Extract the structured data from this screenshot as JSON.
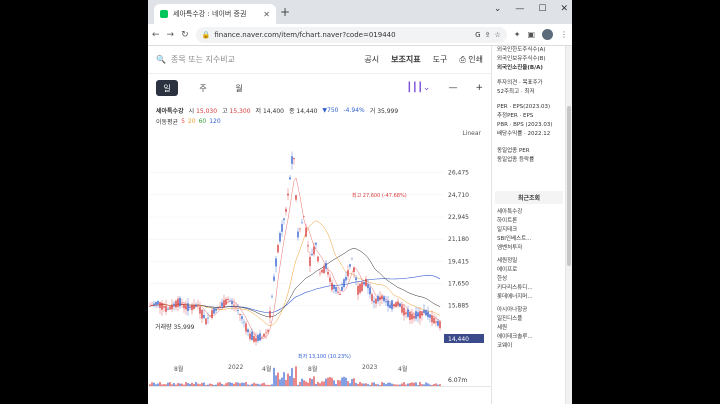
{
  "browser": {
    "tab_title": "세아특수강 : 네이버 증권",
    "url": "finance.naver.com/item/fchart.naver?code=019440"
  },
  "topbar": {
    "search_placeholder": "종목 또는 지수비교",
    "links": [
      "공시",
      "보조지표",
      "도구",
      "인쇄"
    ]
  },
  "periods": [
    "일",
    "주",
    "월"
  ],
  "quote": {
    "name": "세아특수강",
    "open_label": "시",
    "open": "15,030",
    "high_label": "고",
    "high": "15,300",
    "low_label": "저",
    "low": "14,400",
    "close_label": "종",
    "close": "14,440",
    "change": "▼750",
    "change_pct": "-4.94%",
    "volume_label": "거",
    "volume": "35,999"
  },
  "moving_average": {
    "label": "이동평균",
    "values": [
      "5",
      "20",
      "60",
      "120"
    ]
  },
  "scale_mode": "Linear",
  "price_axis": [
    "26,475",
    "24,710",
    "22,945",
    "21,180",
    "19,415",
    "17,650",
    "15,885"
  ],
  "current_price_tag": "14,440",
  "annotations": {
    "max": "최고 27,600 (-47.68%)",
    "min": "최저 13,100 (10.23%)"
  },
  "volume_panel": {
    "label": "거래량",
    "value": "35,999",
    "max_tick": "6.07m"
  },
  "time_axis": [
    "8월",
    "2022",
    "4월",
    "8월",
    "2023",
    "4월"
  ],
  "colors": {
    "up": "#d83a3a",
    "down": "#2f5fd0",
    "ma5": "#e84a4a",
    "ma20": "#f0a030",
    "ma60": "#3aa03a",
    "ma120": "#3a60d0",
    "accent": "#3a4a8a"
  },
  "side_panel": {
    "top_rows": [
      "외국인한도주식수(A)",
      "외국인보유주식수(B)",
      "외국인소진율(B/A)",
      "투자의견 · 목표주가",
      "52주최고 · 최저"
    ],
    "mid_rows": [
      "PER · EPS(2023.03)",
      "추정PER · EPS",
      "PBR · BPS (2023.03)",
      "배당수익률 · 2022.12"
    ],
    "sector_rows": [
      "동일업종 PER",
      "동일업종 등락률"
    ],
    "recent_header": "최근조회",
    "recent_items": [
      "세아특수강",
      "하이트론",
      "일지테크",
      "SBI인베스트...",
      "엠벤처투자",
      "세원정밀",
      "에이프로",
      "한성",
      "키다리스튜디...",
      "롯데에너지머...",
      "아시아나항공",
      "일진디스플",
      "세원",
      "에이테크솔루...",
      "코웨이"
    ]
  }
}
